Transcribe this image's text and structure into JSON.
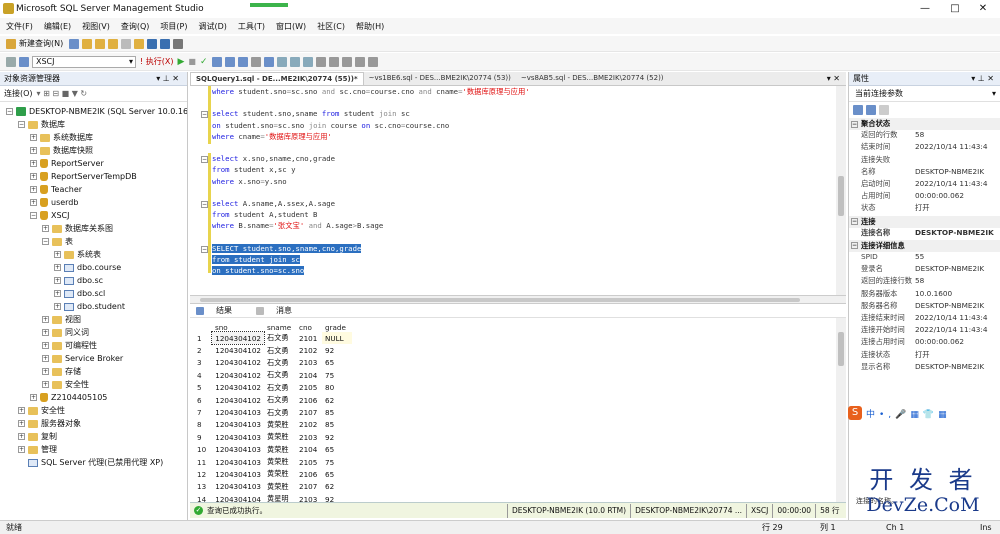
{
  "window": {
    "title": "Microsoft SQL Server Management Studio",
    "min": "—",
    "max": "□",
    "close": "✕"
  },
  "menu": [
    "文件(F)",
    "编辑(E)",
    "视图(V)",
    "查询(Q)",
    "项目(P)",
    "调试(D)",
    "工具(T)",
    "窗口(W)",
    "社区(C)",
    "帮助(H)"
  ],
  "toolbar": {
    "new_query": "新建查询(N)",
    "database": "XSCJ",
    "execute": "! 执行(X)"
  },
  "object_explorer": {
    "title": "对象资源管理器",
    "connect": "连接(O)",
    "nodes": [
      {
        "label": "DESKTOP-NBME2IK (SQL Server 10.0.160",
        "level": 0,
        "icon": "server",
        "exp": "−"
      },
      {
        "label": "数据库",
        "level": 1,
        "icon": "folder",
        "exp": "−"
      },
      {
        "label": "系统数据库",
        "level": 2,
        "icon": "folder",
        "exp": "+"
      },
      {
        "label": "数据库快照",
        "level": 2,
        "icon": "folder",
        "exp": "+"
      },
      {
        "label": "ReportServer",
        "level": 2,
        "icon": "db",
        "exp": "+"
      },
      {
        "label": "ReportServerTempDB",
        "level": 2,
        "icon": "db",
        "exp": "+"
      },
      {
        "label": "Teacher",
        "level": 2,
        "icon": "db",
        "exp": "+"
      },
      {
        "label": "userdb",
        "level": 2,
        "icon": "db",
        "exp": "+"
      },
      {
        "label": "XSCJ",
        "level": 2,
        "icon": "db",
        "exp": "−"
      },
      {
        "label": "数据库关系图",
        "level": 3,
        "icon": "folder",
        "exp": "+"
      },
      {
        "label": "表",
        "level": 3,
        "icon": "folder",
        "exp": "−"
      },
      {
        "label": "系统表",
        "level": 4,
        "icon": "folder",
        "exp": "+"
      },
      {
        "label": "dbo.course",
        "level": 4,
        "icon": "table",
        "exp": "+"
      },
      {
        "label": "dbo.sc",
        "level": 4,
        "icon": "table",
        "exp": "+"
      },
      {
        "label": "dbo.scl",
        "level": 4,
        "icon": "table",
        "exp": "+"
      },
      {
        "label": "dbo.student",
        "level": 4,
        "icon": "table",
        "exp": "+"
      },
      {
        "label": "视图",
        "level": 3,
        "icon": "folder",
        "exp": "+"
      },
      {
        "label": "同义词",
        "level": 3,
        "icon": "folder",
        "exp": "+"
      },
      {
        "label": "可编程性",
        "level": 3,
        "icon": "folder",
        "exp": "+"
      },
      {
        "label": "Service Broker",
        "level": 3,
        "icon": "folder",
        "exp": "+"
      },
      {
        "label": "存储",
        "level": 3,
        "icon": "folder",
        "exp": "+"
      },
      {
        "label": "安全性",
        "level": 3,
        "icon": "folder",
        "exp": "+"
      },
      {
        "label": "Z2104405105",
        "level": 2,
        "icon": "db",
        "exp": "+"
      },
      {
        "label": "安全性",
        "level": 1,
        "icon": "folder",
        "exp": "+"
      },
      {
        "label": "服务器对象",
        "level": 1,
        "icon": "folder",
        "exp": "+"
      },
      {
        "label": "复制",
        "level": 1,
        "icon": "folder",
        "exp": "+"
      },
      {
        "label": "管理",
        "level": 1,
        "icon": "folder",
        "exp": "+"
      },
      {
        "label": "SQL Server 代理(已禁用代理 XP)",
        "level": 1,
        "icon": "agent",
        "exp": ""
      }
    ]
  },
  "doc_tabs": [
    "SQLQuery1.sql - DE...ME2IK\\20774 (55))*",
    "~vs1BE6.sql - DES...BME2IK\\20774 (53))",
    "~vs8AB5.sql - DES...BME2IK\\20774 (52))"
  ],
  "editor_lines": [
    [
      [
        "kw",
        "where "
      ],
      [
        "t",
        "student.sno"
      ],
      [
        "op",
        "="
      ],
      [
        "t",
        "sc.sno "
      ],
      [
        "op",
        "and "
      ],
      [
        "t",
        "sc.cno"
      ],
      [
        "op",
        "="
      ],
      [
        "t",
        "course.cno "
      ],
      [
        "op",
        "and "
      ],
      [
        "t",
        "cname"
      ],
      [
        "op",
        "="
      ],
      [
        "str",
        "'数据库原理与应用'"
      ]
    ],
    [],
    [
      [
        "kw",
        "select "
      ],
      [
        "t",
        "student.sno,sname "
      ],
      [
        "kw",
        "from "
      ],
      [
        "t",
        "student "
      ],
      [
        "op",
        "join "
      ],
      [
        "t",
        "sc"
      ]
    ],
    [
      [
        "kw",
        "on "
      ],
      [
        "t",
        "student.sno"
      ],
      [
        "op",
        "="
      ],
      [
        "t",
        "sc.sno "
      ],
      [
        "op",
        "join "
      ],
      [
        "t",
        "course "
      ],
      [
        "kw",
        "on "
      ],
      [
        "t",
        "sc.cno"
      ],
      [
        "op",
        "="
      ],
      [
        "t",
        "course.cno"
      ]
    ],
    [
      [
        "kw",
        "where "
      ],
      [
        "t",
        "cname"
      ],
      [
        "op",
        "="
      ],
      [
        "str",
        "'数据库原理与应用'"
      ]
    ],
    [],
    [
      [
        "kw",
        "select "
      ],
      [
        "t",
        "x.sno,sname,cno,grade"
      ]
    ],
    [
      [
        "kw",
        "from "
      ],
      [
        "t",
        "student x,sc y"
      ]
    ],
    [
      [
        "kw",
        "where "
      ],
      [
        "t",
        "x.sno"
      ],
      [
        "op",
        "="
      ],
      [
        "t",
        "y.sno"
      ]
    ],
    [],
    [
      [
        "kw",
        "select "
      ],
      [
        "t",
        "A.sname,A.ssex,A.sage"
      ]
    ],
    [
      [
        "kw",
        "from "
      ],
      [
        "t",
        "student A,student B"
      ]
    ],
    [
      [
        "kw",
        "where "
      ],
      [
        "t",
        "B.sname"
      ],
      [
        "op",
        "="
      ],
      [
        "str",
        "'张文宝' "
      ],
      [
        "op",
        "and "
      ],
      [
        "t",
        "A.sage"
      ],
      [
        "op",
        ">"
      ],
      [
        "t",
        "B.sage"
      ]
    ],
    [],
    [
      [
        "sel",
        "SELECT student.sno,sname,cno,grade"
      ]
    ],
    [
      [
        "sel",
        "from student join sc"
      ]
    ],
    [
      [
        "sel",
        "on student.sno=sc.sno"
      ]
    ]
  ],
  "results": {
    "tab_results": "结果",
    "tab_messages": "消息",
    "columns": [
      "sno",
      "sname",
      "cno",
      "grade"
    ],
    "rows": [
      [
        "1",
        "1204304102",
        "石文勇",
        "2101",
        "NULL"
      ],
      [
        "2",
        "1204304102",
        "石文勇",
        "2102",
        "92"
      ],
      [
        "3",
        "1204304102",
        "石文勇",
        "2103",
        "65"
      ],
      [
        "4",
        "1204304102",
        "石文勇",
        "2104",
        "75"
      ],
      [
        "5",
        "1204304102",
        "石文勇",
        "2105",
        "80"
      ],
      [
        "6",
        "1204304102",
        "石文勇",
        "2106",
        "62"
      ],
      [
        "7",
        "1204304103",
        "石文勇",
        "2107",
        "85"
      ],
      [
        "8",
        "1204304103",
        "黄荣胜",
        "2102",
        "85"
      ],
      [
        "9",
        "1204304103",
        "黄荣胜",
        "2103",
        "92"
      ],
      [
        "10",
        "1204304103",
        "黄荣胜",
        "2104",
        "65"
      ],
      [
        "11",
        "1204304103",
        "黄荣胜",
        "2105",
        "75"
      ],
      [
        "12",
        "1204304103",
        "黄荣胜",
        "2106",
        "65"
      ],
      [
        "13",
        "1204304103",
        "黄荣胜",
        "2107",
        "62"
      ],
      [
        "14",
        "1204304104",
        "黄星明",
        "2103",
        "92"
      ]
    ]
  },
  "status_bar": {
    "message": "查询已成功执行。",
    "server": "DESKTOP-NBME2IK (10.0 RTM)",
    "user": "DESKTOP-NBME2IK\\20774 ...",
    "db": "XSCJ",
    "time": "00:00:00",
    "rows": "58 行"
  },
  "properties": {
    "title": "属性",
    "current": "当前连接参数",
    "sections": [
      {
        "head": "聚合状态",
        "rows": [
          [
            "返回的行数",
            "58"
          ],
          [
            "结束时间",
            "2022/10/14 11:43:4"
          ],
          [
            "连接失败",
            ""
          ],
          [
            "名称",
            "DESKTOP-NBME2IK"
          ],
          [
            "启动时间",
            "2022/10/14 11:43:4"
          ],
          [
            "占用时间",
            "00:00:00.062"
          ],
          [
            "状态",
            "打开"
          ]
        ]
      },
      {
        "head": "连接",
        "rows": [
          [
            "连接名称",
            "DESKTOP-NBME2IK"
          ]
        ]
      },
      {
        "head": "连接详细信息",
        "rows": [
          [
            "SPID",
            "55"
          ],
          [
            "登录名",
            "DESKTOP-NBME2IK"
          ],
          [
            "返回的连接行数",
            "58"
          ],
          [
            "服务器版本",
            "10.0.1600"
          ],
          [
            "服务器名称",
            "DESKTOP-NBME2IK"
          ],
          [
            "连接结束时间",
            "2022/10/14 11:43:4"
          ],
          [
            "连接开始时间",
            "2022/10/14 11:43:4"
          ],
          [
            "连接占用时间",
            "00:00:00.062"
          ],
          [
            "连接状态",
            "打开"
          ],
          [
            "显示名称",
            "DESKTOP-NBME2IK"
          ]
        ]
      }
    ],
    "desc_label": "连接的名称。"
  },
  "bottom": {
    "ready": "就绪",
    "row": "行 29",
    "col": "列 1",
    "ch": "Ch 1",
    "ins": "Ins"
  },
  "watermark": {
    "line1": "开 发 者",
    "line2": "DevZe.CoM"
  }
}
